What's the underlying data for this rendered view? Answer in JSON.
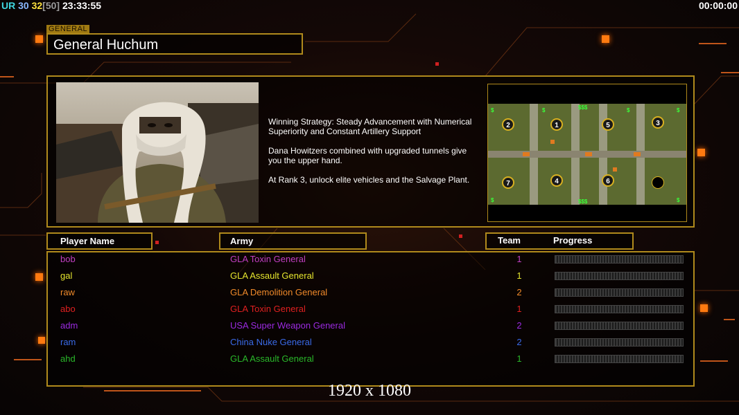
{
  "hud": {
    "ur": "UR",
    "n1": "30",
    "n2": "32",
    "n3": "[50]",
    "clock": "23:33:55",
    "timer": "00:00:00"
  },
  "general": {
    "tag": "GENERAL",
    "name": "General Huchum"
  },
  "description": [
    "Winning Strategy: Steady Advancement with Numerical\n Superiority and Constant Artillery Support",
    "Dana Howitzers combined with upgraded tunnels give\n you the upper hand.",
    "At Rank 3, unlock elite vehicles and the Salvage Plant."
  ],
  "map": {
    "start_positions": [
      "2",
      "1",
      "5",
      "3",
      "7",
      "4",
      "6",
      ""
    ],
    "cash_label": "$$$",
    "small_cash": "$"
  },
  "columns": {
    "player": "Player Name",
    "army": "Army",
    "team": "Team",
    "progress": "Progress"
  },
  "players": [
    {
      "name": "bob",
      "army": "GLA Toxin General",
      "team": "1",
      "color": "#c23fc2"
    },
    {
      "name": "gal",
      "army": "GLA Assault General",
      "team": "1",
      "color": "#e6e62e"
    },
    {
      "name": "raw",
      "army": "GLA Demolition General",
      "team": "2",
      "color": "#f08a2a"
    },
    {
      "name": "abo",
      "army": "GLA Toxin General",
      "team": "1",
      "color": "#e02020"
    },
    {
      "name": "adm",
      "army": "USA Super Weapon General",
      "team": "2",
      "color": "#9a2ae0"
    },
    {
      "name": "ram",
      "army": "China Nuke General",
      "team": "2",
      "color": "#3a6ae8"
    },
    {
      "name": "ahd",
      "army": "GLA Assault General",
      "team": "1",
      "color": "#2ab82a"
    }
  ],
  "resolution_label": "1920 x 1080",
  "colors": {
    "frame": "#b08a1c",
    "accent": "#ff7a10"
  }
}
